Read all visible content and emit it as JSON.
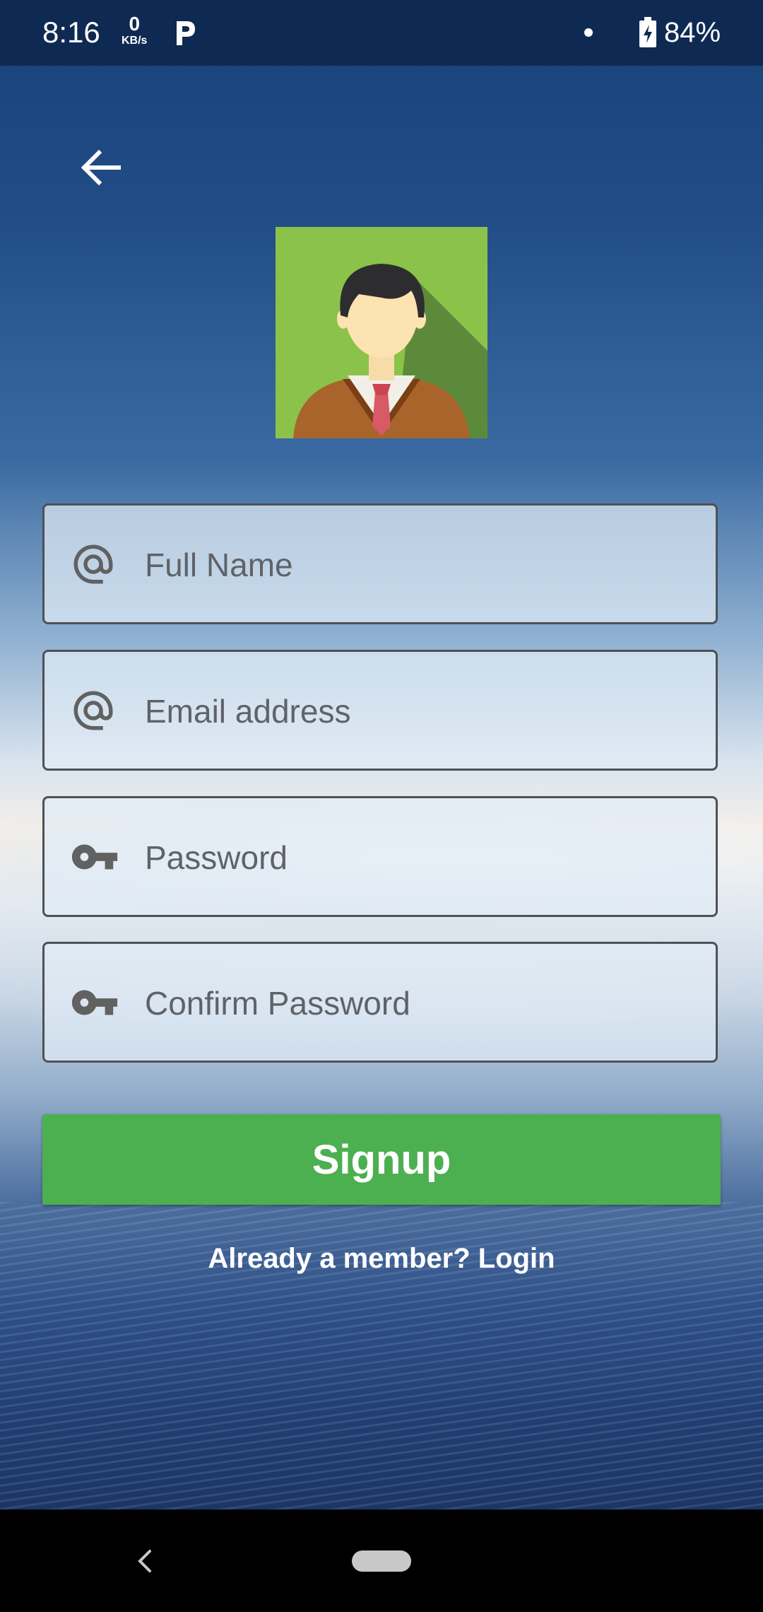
{
  "status_bar": {
    "time": "8:16",
    "net_speed_value": "0",
    "net_speed_unit": "KB/s",
    "battery_percent": "84%"
  },
  "form": {
    "full_name_placeholder": "Full Name",
    "email_placeholder": "Email address",
    "password_placeholder": "Password",
    "confirm_password_placeholder": "Confirm Password",
    "signup_label": "Signup",
    "login_link": "Already a member? Login"
  },
  "icons": {
    "back": "arrow-left-icon",
    "at": "at-sign-icon",
    "key": "key-icon"
  },
  "colors": {
    "primary": "#4caf50",
    "status_bar": "#0f2a52"
  }
}
